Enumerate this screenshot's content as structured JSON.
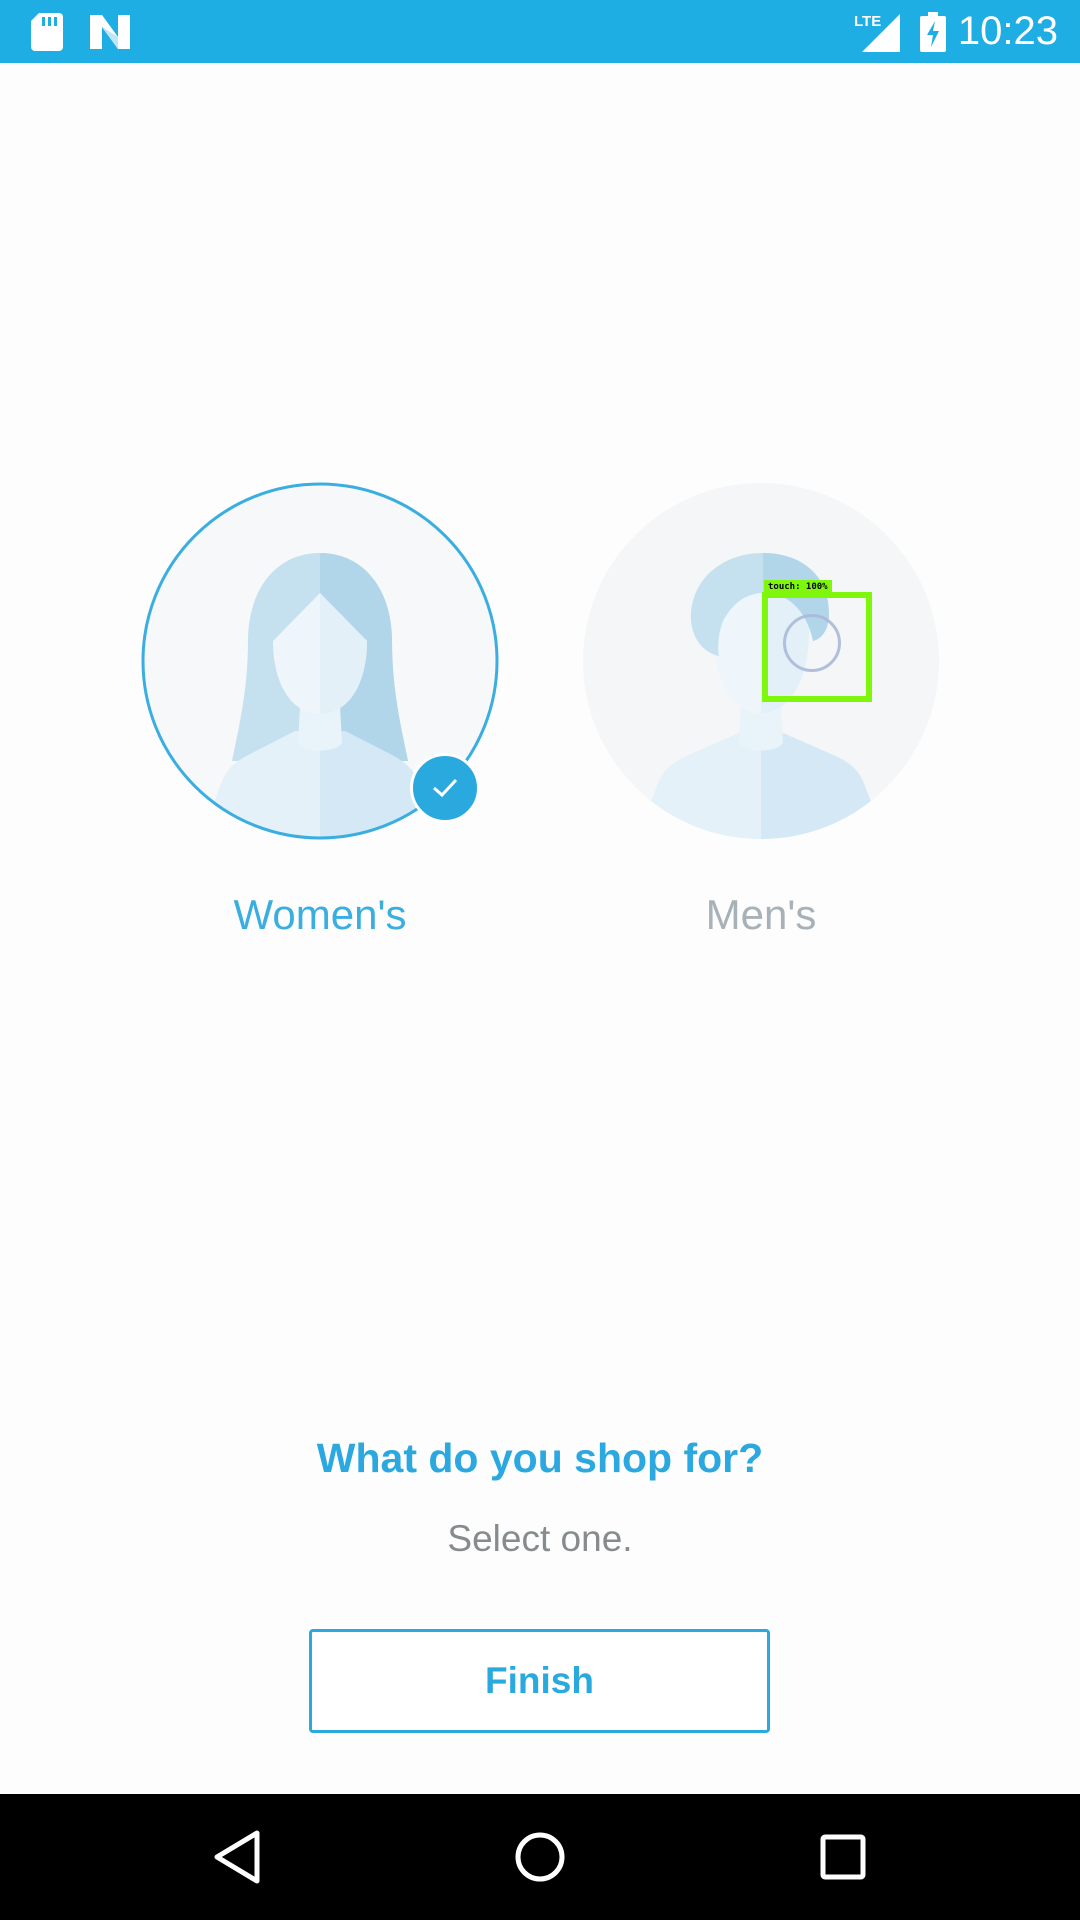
{
  "status_bar": {
    "time": "10:23",
    "left_icons": [
      "sd-card-icon",
      "n-logo-icon"
    ],
    "right_icons": [
      "lte-signal-icon",
      "battery-charging-icon"
    ],
    "network_label": "LTE",
    "color": "#1faee3"
  },
  "options": [
    {
      "label": "Women's",
      "selected": true,
      "icon": "woman-avatar-icon"
    },
    {
      "label": "Men's",
      "selected": false,
      "icon": "man-avatar-icon"
    }
  ],
  "prompt": {
    "title": "What do you shop for?",
    "subtitle": "Select one."
  },
  "finish_button": {
    "label": "Finish"
  },
  "touch_overlay": {
    "label": "touch: 100%"
  },
  "nav_bar": {
    "icons": [
      "back-icon",
      "home-icon",
      "recents-icon"
    ]
  },
  "colors": {
    "accent": "#2aa9de",
    "unselected_label": "#a7b2b8",
    "subtitle": "#868b8e",
    "touch_highlight": "#7ef70c"
  }
}
